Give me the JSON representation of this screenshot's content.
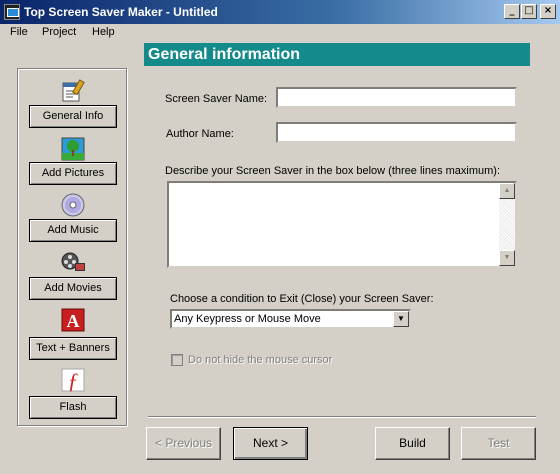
{
  "window": {
    "title": "Top Screen Saver Maker - Untitled",
    "controls": {
      "minimize": "_",
      "maximize": "□",
      "close": "×"
    }
  },
  "menu": [
    "File",
    "Project",
    "Help"
  ],
  "sidebar": {
    "items": [
      {
        "label": "General Info",
        "icon": "document-edit-icon"
      },
      {
        "label": "Add Pictures",
        "icon": "picture-tree-icon"
      },
      {
        "label": "Add Music",
        "icon": "cd-disc-icon"
      },
      {
        "label": "Add Movies",
        "icon": "film-reel-icon"
      },
      {
        "label": "Text + Banners",
        "icon": "letter-a-icon",
        "glyph": "A"
      },
      {
        "label": "Flash",
        "icon": "flash-icon",
        "glyph": "ƒ"
      }
    ]
  },
  "main": {
    "header": "General information",
    "screensaver_name_label": "Screen Saver Name:",
    "screensaver_name_value": "",
    "author_name_label": "Author Name:",
    "author_name_value": "",
    "description_label": "Describe your Screen Saver in the box below (three lines maximum):",
    "description_value": "",
    "exit_condition_label": "Choose a condition to Exit (Close) your Screen Saver:",
    "exit_condition_value": "Any Keypress or Mouse Move",
    "hide_cursor_label": "Do not hide the mouse cursor",
    "hide_cursor_checked": false
  },
  "buttons": {
    "previous": "< Previous",
    "next": "Next >",
    "build": "Build",
    "test": "Test"
  },
  "colors": {
    "header_bg": "#158a8a",
    "titlebar_start": "#0a246a",
    "titlebar_end": "#a6caf0"
  }
}
